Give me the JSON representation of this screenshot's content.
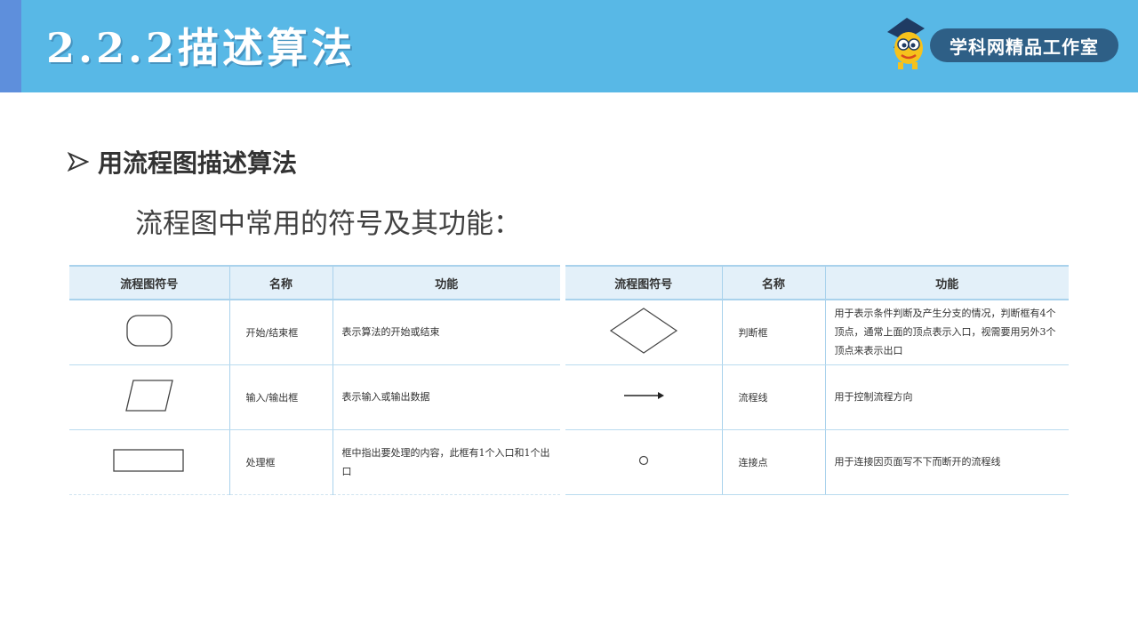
{
  "header": {
    "title": "2.2.2描述算法",
    "logo_text": "学科网精品工作室"
  },
  "section": {
    "bullet": "用流程图描述算法",
    "subtitle": "流程图中常用的符号及其功能："
  },
  "table_left": {
    "headers": [
      "流程图符号",
      "名称",
      "功能"
    ],
    "rows": [
      {
        "symbol": "rounded-rectangle-icon",
        "name": "开始/结束框",
        "function": "表示算法的开始或结束"
      },
      {
        "symbol": "parallelogram-icon",
        "name": "输入/输出框",
        "function": "表示输入或输出数据"
      },
      {
        "symbol": "rectangle-icon",
        "name": "处理框",
        "function": "框中指出要处理的内容，此框有1个入口和1个出口"
      }
    ]
  },
  "table_right": {
    "headers": [
      "流程图符号",
      "名称",
      "功能"
    ],
    "rows": [
      {
        "symbol": "diamond-icon",
        "name": "判断框",
        "function": "用于表示条件判断及产生分支的情况，判断框有4个顶点，通常上面的顶点表示入口，视需要用另外3个顶点来表示出口"
      },
      {
        "symbol": "arrow-icon",
        "name": "流程线",
        "function": "用于控制流程方向"
      },
      {
        "symbol": "circle-icon",
        "name": "连接点",
        "function": "用于连接因页面写不下而断开的流程线"
      }
    ]
  },
  "colors": {
    "header_bg": "#58b8e6",
    "header_stripe": "#5e8fdc",
    "logo_pill": "#2e5f86",
    "table_header_bg": "#e3f0f9"
  }
}
